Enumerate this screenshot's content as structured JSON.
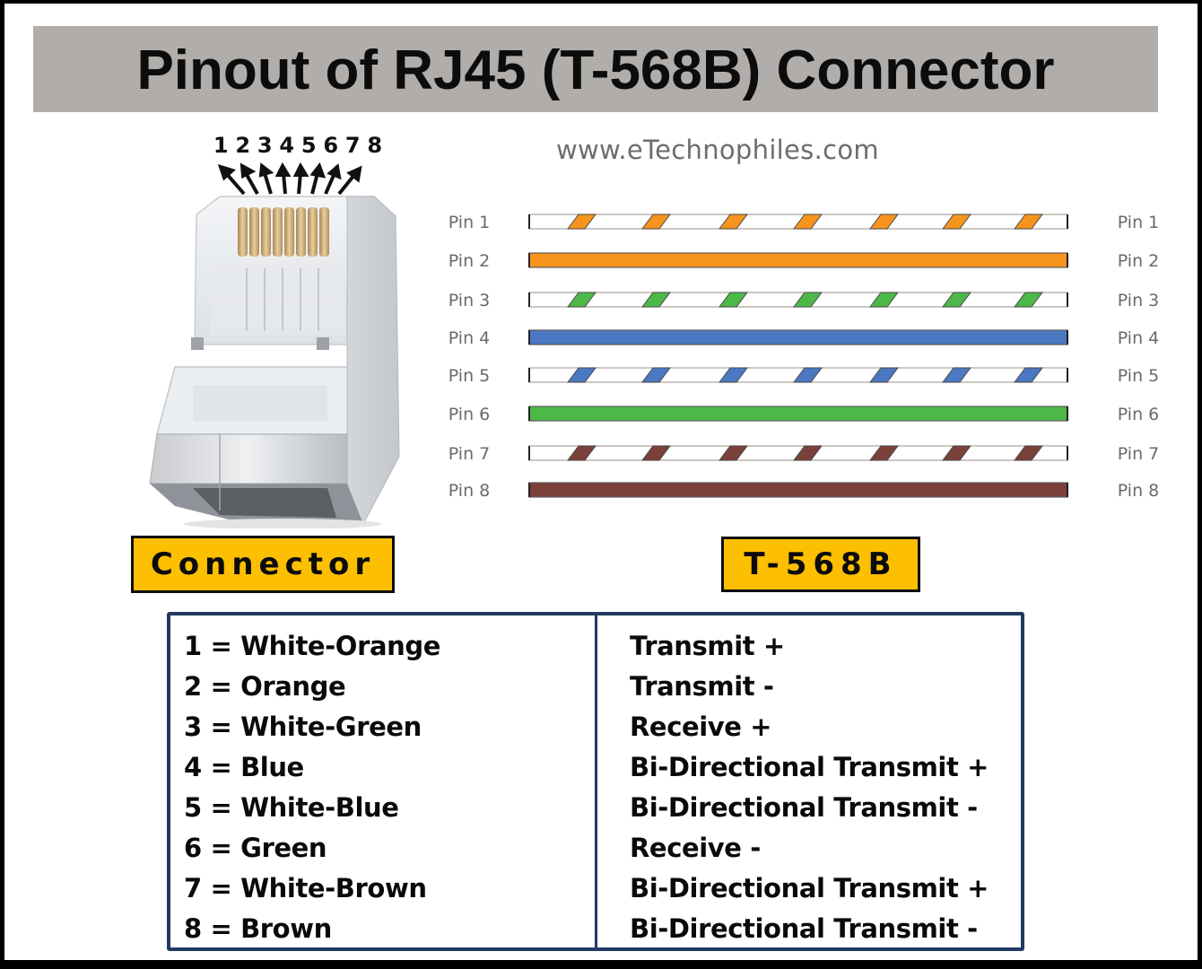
{
  "title": "Pinout of RJ45 (T-568B) Connector",
  "website": "www.eTechnophiles.com",
  "connector": {
    "pin_numbers": [
      "1",
      "2",
      "3",
      "4",
      "5",
      "6",
      "7",
      "8"
    ],
    "label": "Connector"
  },
  "standard_label": "T-568B",
  "colors": {
    "orange": "#f7941d",
    "green": "#4cb848",
    "blue": "#4a78c2",
    "brown": "#7b4039",
    "title_bar": "#b0adab",
    "tag_yellow": "#fdbf01",
    "table_border": "#223a63"
  },
  "wires": [
    {
      "pin": 1,
      "left_label": "Pin 1",
      "right_label": "Pin 1",
      "color": "orange",
      "striped": true
    },
    {
      "pin": 2,
      "left_label": "Pin 2",
      "right_label": "Pin 2",
      "color": "orange",
      "striped": false
    },
    {
      "pin": 3,
      "left_label": "Pin 3",
      "right_label": "Pin 3",
      "color": "green",
      "striped": true
    },
    {
      "pin": 4,
      "left_label": "Pin 4",
      "right_label": "Pin 4",
      "color": "blue",
      "striped": false
    },
    {
      "pin": 5,
      "left_label": "Pin 5",
      "right_label": "Pin 5",
      "color": "blue",
      "striped": true
    },
    {
      "pin": 6,
      "left_label": "Pin 6",
      "right_label": "Pin 6",
      "color": "green",
      "striped": false
    },
    {
      "pin": 7,
      "left_label": "Pin 7",
      "right_label": "Pin 7",
      "color": "brown",
      "striped": true
    },
    {
      "pin": 8,
      "left_label": "Pin 8",
      "right_label": "Pin 8",
      "color": "brown",
      "striped": false
    }
  ],
  "table": {
    "rows": [
      {
        "color_name": "1 = White-Orange",
        "function": "Transmit +"
      },
      {
        "color_name": "2 = Orange",
        "function": "Transmit -"
      },
      {
        "color_name": "3 = White-Green",
        "function": "Receive +"
      },
      {
        "color_name": "4 = Blue",
        "function": "Bi-Directional Transmit +"
      },
      {
        "color_name": "5 = White-Blue",
        "function": "Bi-Directional Transmit -"
      },
      {
        "color_name": "6 = Green",
        "function": "Receive -"
      },
      {
        "color_name": "7 = White-Brown",
        "function": "Bi-Directional Transmit +"
      },
      {
        "color_name": "8 = Brown",
        "function": "Bi-Directional Transmit -"
      }
    ]
  }
}
